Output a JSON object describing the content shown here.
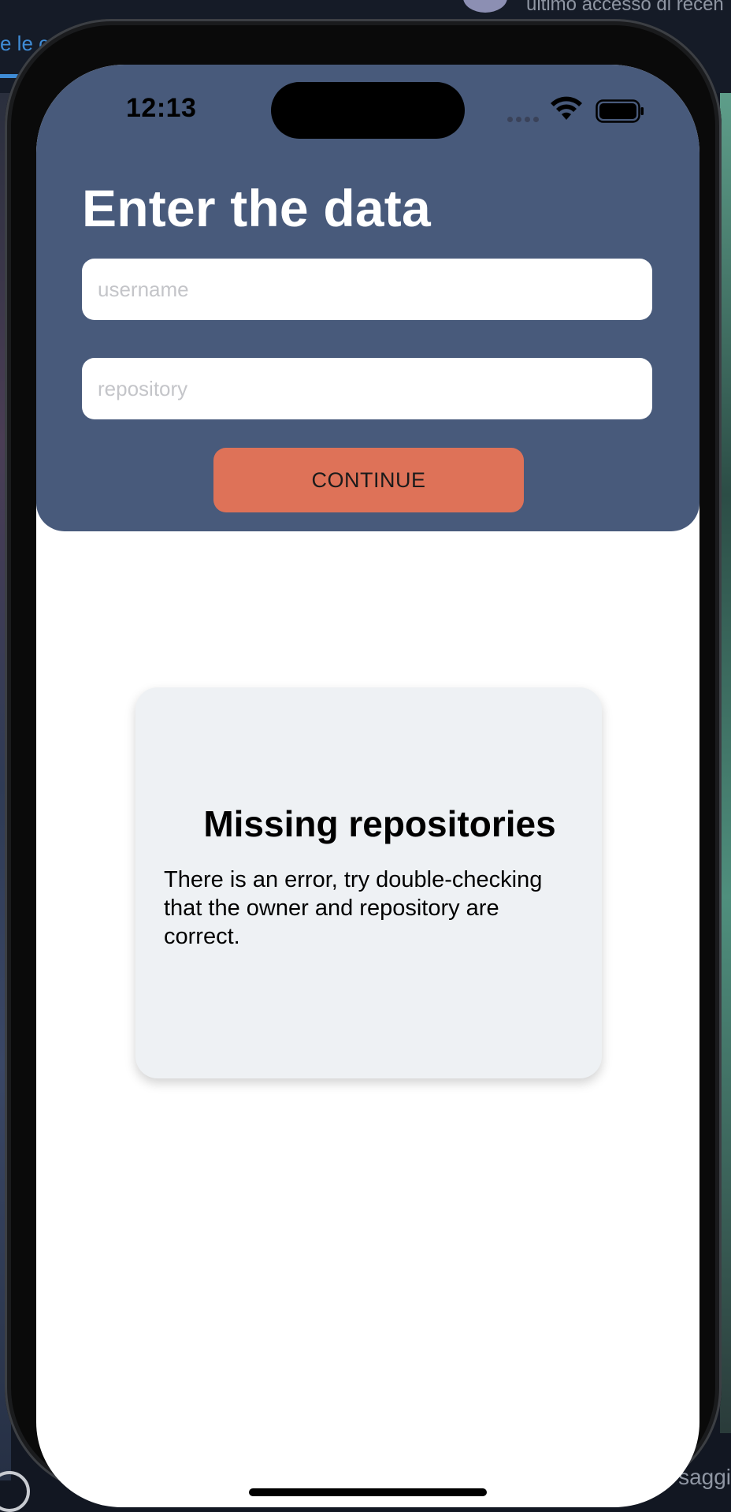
{
  "background": {
    "top_right_text": "ultimo accesso di recen",
    "left_text": "e le c",
    "bottom_right_text": "saggi"
  },
  "status_bar": {
    "time": "12:13",
    "icons": [
      "signal-icon",
      "wifi-icon",
      "battery-icon"
    ]
  },
  "header": {
    "title": "Enter the data",
    "username": {
      "placeholder": "username",
      "value": ""
    },
    "repository": {
      "placeholder": "repository",
      "value": ""
    },
    "continue_label": "CONTINUE"
  },
  "error_card": {
    "title": "Missing repositories",
    "message": "There is an error, try double-checking that the owner and repository are correct."
  },
  "colors": {
    "header_background": "#485a7b",
    "button_background": "#de7258",
    "card_background": "#eef1f4",
    "title_text": "#ffffff"
  }
}
